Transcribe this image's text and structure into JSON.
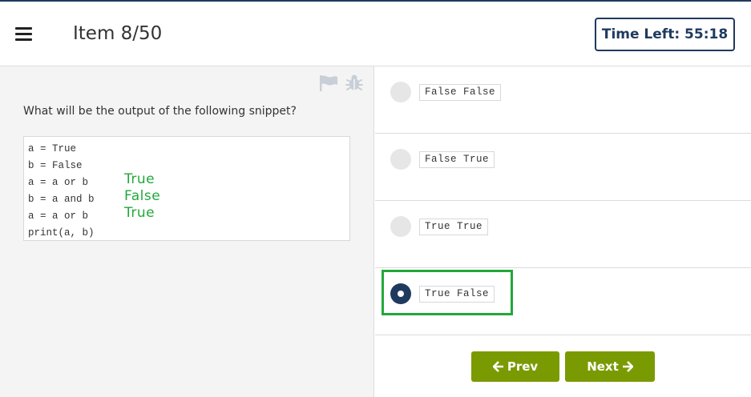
{
  "header": {
    "item_title": "Item 8/50",
    "timer_text": "Time Left: 55:18"
  },
  "icons": {
    "menu": "menu-icon",
    "flag": "flag-icon",
    "bug": "bug-icon",
    "prev_arrow": "arrow-left-icon",
    "next_arrow": "arrow-right-icon"
  },
  "question": {
    "text": "What will be the output of the following snippet?",
    "code_lines": [
      {
        "code": "a = True",
        "annotation": ""
      },
      {
        "code": "b = False",
        "annotation": ""
      },
      {
        "code": "a = a or b",
        "annotation": "True"
      },
      {
        "code": "b = a and b",
        "annotation": "False"
      },
      {
        "code": "a = a or b",
        "annotation": "True"
      },
      {
        "code": "print(a, b)",
        "annotation": ""
      }
    ]
  },
  "options": [
    {
      "label": "False False",
      "selected": false
    },
    {
      "label": "False True",
      "selected": false
    },
    {
      "label": "True True",
      "selected": false
    },
    {
      "label": "True False",
      "selected": true
    }
  ],
  "nav": {
    "prev_label": "Prev",
    "next_label": "Next"
  },
  "colors": {
    "accent_navy": "#1f3a5f",
    "button_green": "#7a9a01",
    "annotation_green": "#22a83a"
  }
}
